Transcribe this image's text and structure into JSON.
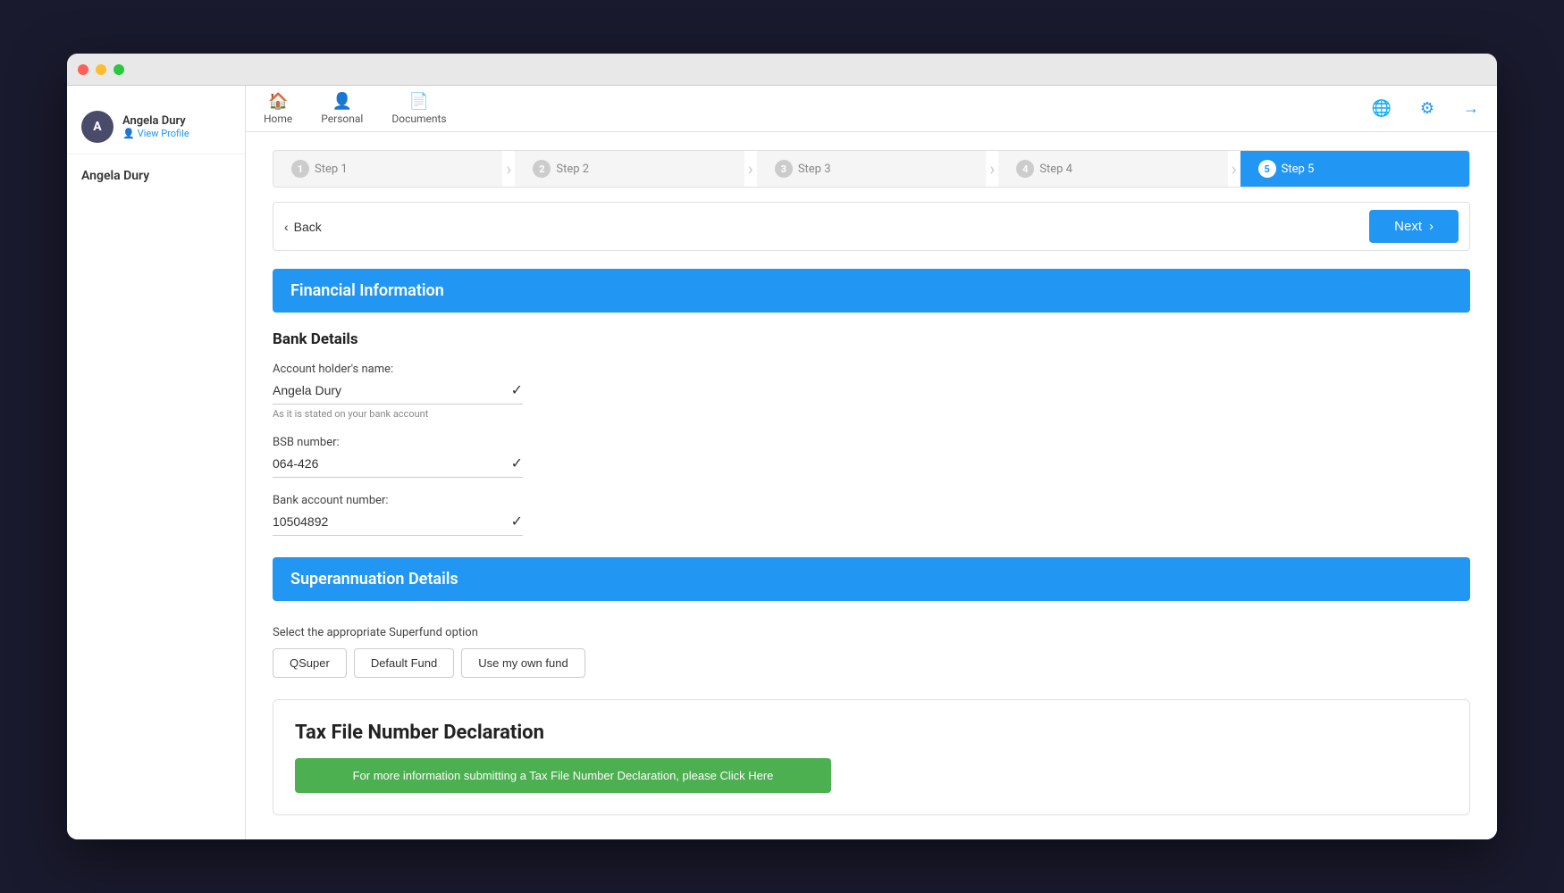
{
  "browser": {
    "dots": [
      "red",
      "yellow",
      "green"
    ]
  },
  "user": {
    "name": "Angela Dury",
    "view_profile": "View Profile",
    "initials": "A"
  },
  "nav": {
    "items": [
      {
        "label": "Home",
        "icon": "🏠"
      },
      {
        "label": "Personal",
        "icon": "👤"
      },
      {
        "label": "Documents",
        "icon": "📄"
      }
    ]
  },
  "steps": [
    {
      "num": "1",
      "label": "Step 1",
      "active": false
    },
    {
      "num": "2",
      "label": "Step 2",
      "active": false
    },
    {
      "num": "3",
      "label": "Step 3",
      "active": false
    },
    {
      "num": "4",
      "label": "Step 4",
      "active": false
    },
    {
      "num": "5",
      "label": "Step 5",
      "active": true
    }
  ],
  "navigation": {
    "back_label": "Back",
    "next_label": "Next"
  },
  "financial_info": {
    "title": "Financial Information",
    "bank_details": {
      "title": "Bank Details",
      "account_holder_label": "Account holder's name:",
      "account_holder_value": "Angela Dury",
      "account_holder_hint": "As it is stated on your bank account",
      "bsb_label": "BSB number:",
      "bsb_value": "064-426",
      "bank_account_label": "Bank account number:",
      "bank_account_value": "10504892"
    },
    "super_details": {
      "title": "Superannuation Details",
      "select_label": "Select the appropriate Superfund option",
      "options": [
        "QSuper",
        "Default Fund",
        "Use my own fund"
      ]
    },
    "tfn": {
      "title": "Tax File Number Declaration",
      "link_text": "For more information submitting a Tax File Number Declaration, please Click Here"
    }
  },
  "top_icons": {
    "globe": "🌐",
    "settings": "⚙",
    "logout": "→"
  }
}
